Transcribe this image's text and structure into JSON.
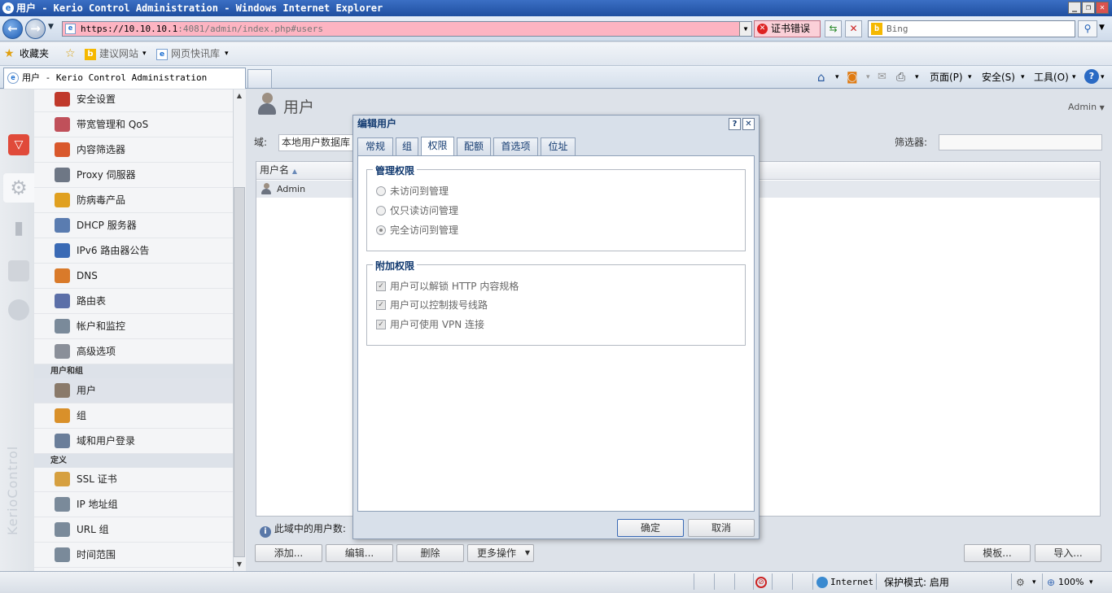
{
  "window": {
    "title": "用户 - Kerio Control Administration - Windows Internet Explorer"
  },
  "browser": {
    "url_prefix": "https://10.10.10.1",
    "url_rest": ":4081/admin/index.php#users",
    "cert_error": "证书错误",
    "search_placeholder": "Bing",
    "favorites": "收藏夹",
    "suggested_sites": "建议网站",
    "web_slice": "网页快讯库",
    "tab_title": "用户 - Kerio Control Administration",
    "page_menu": "页面(P)",
    "safety_menu": "安全(S)",
    "tools_menu": "工具(O)"
  },
  "brand": "KerioControl",
  "sidebar": {
    "items_top": [
      {
        "label": "安全设置",
        "color": "#c0392b"
      },
      {
        "label": "带宽管理和 QoS",
        "color": "#c0505a"
      },
      {
        "label": "内容筛选器",
        "color": "#d9582c"
      },
      {
        "label": "Proxy 伺服器",
        "color": "#6e7785"
      },
      {
        "label": "防病毒产品",
        "color": "#e0a020"
      },
      {
        "label": "DHCP 服务器",
        "color": "#5a7cb0"
      },
      {
        "label": "IPv6 路由器公告",
        "color": "#3a6ab5"
      },
      {
        "label": "DNS",
        "color": "#d97a2a"
      },
      {
        "label": "路由表",
        "color": "#5b6fa8"
      },
      {
        "label": "帐户和监控",
        "color": "#7a8a9a"
      },
      {
        "label": "高级选项",
        "color": "#8a8f99"
      }
    ],
    "section_users": "用户和组",
    "items_users": [
      {
        "label": "用户",
        "color": "#8a7a6a"
      },
      {
        "label": "组",
        "color": "#d9902a"
      },
      {
        "label": "域和用户登录",
        "color": "#6a7e9a"
      }
    ],
    "section_defs": "定义",
    "items_defs": [
      {
        "label": "SSL 证书",
        "color": "#d6a040"
      },
      {
        "label": "IP 地址组",
        "color": "#7a8a9a"
      },
      {
        "label": "URL 组",
        "color": "#7a8a9a"
      },
      {
        "label": "时间范围",
        "color": "#7a8a9a"
      }
    ]
  },
  "main": {
    "title": "用户",
    "admin_menu": "Admin",
    "domain_label": "域:",
    "domain_value": "本地用户数据库",
    "filter_label": "筛选器:",
    "grid_header": "用户名",
    "grid_rows": [
      "Admin"
    ],
    "user_count": "此域中的用户数:",
    "buttons": {
      "add": "添加...",
      "edit": "编辑...",
      "delete": "删除",
      "more": "更多操作",
      "template": "模板...",
      "import": "导入..."
    }
  },
  "dialog": {
    "title": "编辑用户",
    "tabs": [
      "常规",
      "组",
      "权限",
      "配额",
      "首选项",
      "位址"
    ],
    "admin_rights_legend": "管理权限",
    "admin_options": [
      "未访问到管理",
      "仅只读访问管理",
      "完全访问到管理"
    ],
    "extra_rights_legend": "附加权限",
    "extra_options": [
      "用户可以解锁 HTTP 内容规格",
      "用户可以控制拨号线路",
      "用户可使用 VPN 连接"
    ],
    "ok": "确定",
    "cancel": "取消"
  },
  "status": {
    "zone": "Internet",
    "protected_mode": "保护模式: 启用",
    "zoom": "100%"
  }
}
